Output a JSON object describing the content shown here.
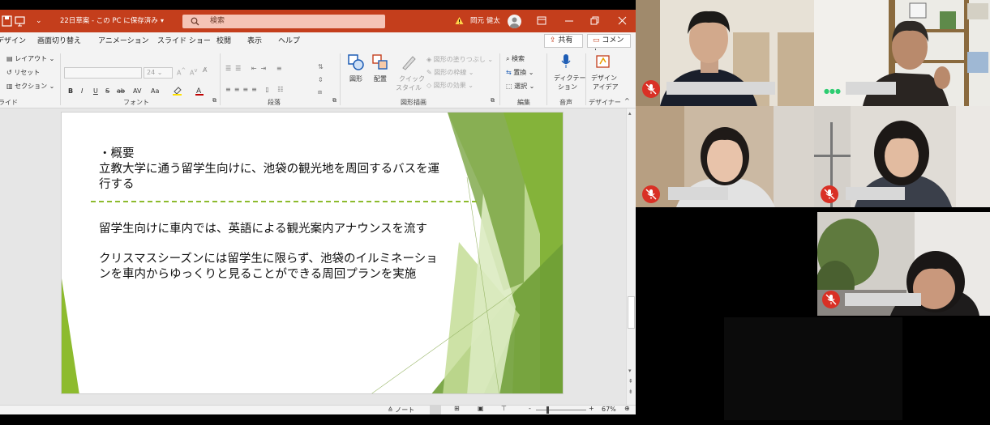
{
  "titlebar": {
    "doc_title": "22日草案 - この PC に保存済み",
    "search_placeholder": "検索",
    "user_name": "岡元 健太"
  },
  "tabs": [
    "デザイン",
    "画面切り替え",
    "アニメーション",
    "スライド ショー",
    "校閲",
    "表示",
    "ヘルプ"
  ],
  "share_label": "共有",
  "comment_label": "コメント",
  "ribbon": {
    "slides": {
      "layout": "レイアウト",
      "reset": "リセット",
      "section": "セクション",
      "label": "ライド"
    },
    "font": {
      "size": "24",
      "label": "フォント",
      "buttons": [
        "B",
        "I",
        "U",
        "S",
        "ab",
        "AV",
        "Aa"
      ]
    },
    "paragraph": {
      "label": "段落"
    },
    "drawing": {
      "shapes": "図形",
      "arrange": "配置",
      "quick_styles_1": "クイック",
      "quick_styles_2": "スタイル",
      "fill": "図形の塗りつぶし",
      "outline": "図形の枠線",
      "effects": "図形の効果",
      "label": "図形描画"
    },
    "editing": {
      "find": "検索",
      "replace": "置換",
      "select": "選択",
      "label": "編集"
    },
    "voice": {
      "dictate_1": "ディクテー",
      "dictate_2": "ション",
      "label": "音声"
    },
    "designer": {
      "ideas_1": "デザイン",
      "ideas_2": "アイデア",
      "label": "デザイナー"
    }
  },
  "slide": {
    "heading": "・概要",
    "summary_line1": "立教大学に通う留学生向けに、池袋の観光地を周回するバスを運",
    "summary_line2": "行する",
    "point1": "留学生向けに車内では、英語による観光案内アナウンスを流す",
    "point2_line1": "クリスマスシーズンには留学生に限らず、池袋のイルミネーショ",
    "point2_line2": "ンを車内からゆっくりと見ることができる周回プランを実施"
  },
  "status": {
    "notes": "ノート",
    "zoom": "67%"
  },
  "colors": {
    "titlebar": "#c43e1c",
    "slide_green": "#8dbb2e",
    "mic_off": "#d93025"
  },
  "participants": [
    {
      "id": "p1",
      "muted": true
    },
    {
      "id": "p2",
      "muted": true
    },
    {
      "id": "p3",
      "muted": true
    },
    {
      "id": "p4",
      "muted": true
    },
    {
      "id": "p5",
      "muted": true
    }
  ]
}
